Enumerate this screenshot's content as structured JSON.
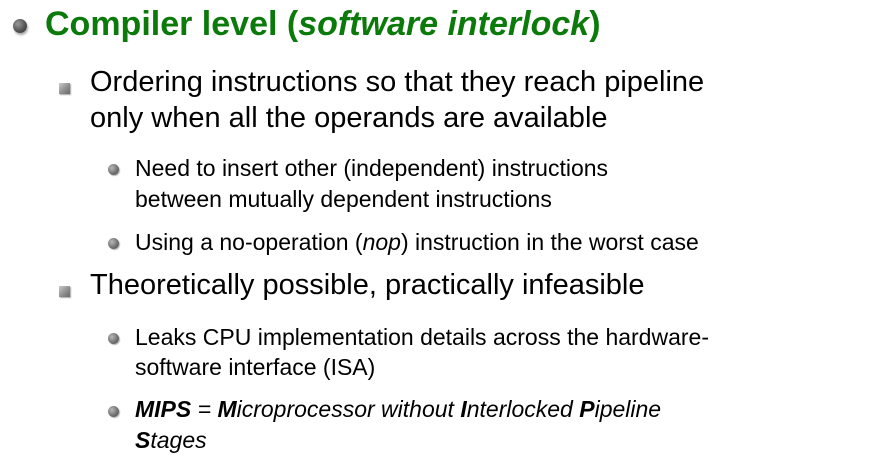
{
  "heading": {
    "prefix": "Compiler level (",
    "emphasis": "software interlock",
    "suffix": ")"
  },
  "points": [
    {
      "lines": [
        "Ordering instructions so that they reach pipeline",
        "only when all the operands are available"
      ],
      "subpoints": [
        {
          "lines": [
            "Need to insert other (independent) instructions",
            "between mutually dependent instructions"
          ]
        },
        {
          "prefix": "Using a no-operation (",
          "emphasis": "nop",
          "suffix": ") instruction in the worst case"
        }
      ]
    },
    {
      "lines": [
        "Theoretically possible, practically infeasible"
      ],
      "subpoints": [
        {
          "lines": [
            "Leaks CPU implementation details across the hardware-",
            "software interface (ISA)"
          ]
        },
        {
          "mips": {
            "term": "MIPS",
            "equals": " = ",
            "m": "M",
            "m_rest": "icroprocessor without ",
            "i": "I",
            "i_rest": "nterlocked ",
            "p": "P",
            "p_rest": "ipeline",
            "s": "S",
            "s_rest": "tages"
          }
        }
      ]
    }
  ]
}
